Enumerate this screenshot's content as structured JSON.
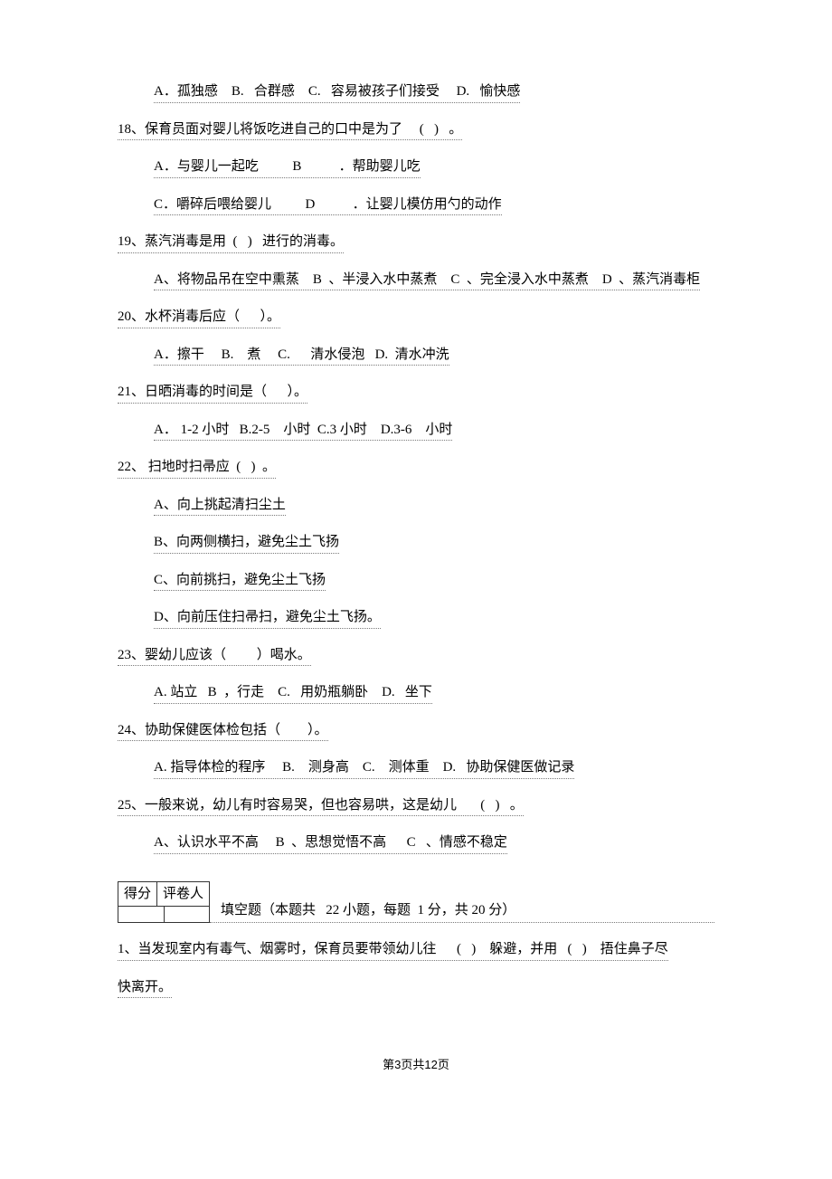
{
  "q17_opts": "A．孤独感    B.   合群感    C.   容易被孩子们接受     D.   愉快感",
  "q18": "18、保育员面对婴儿将饭吃进自己的口中是为了     (   )   。",
  "q18_a": "A．与婴儿一起吃          B           ．帮助婴儿吃",
  "q18_b": "C．嚼碎后喂给婴儿          D           ．让婴儿模仿用勺的动作",
  "q19": "19、蒸汽消毒是用  (   )   进行的消毒。",
  "q19_a": "A、将物品吊在空中熏蒸    B  、半浸入水中蒸煮    C  、完全浸入水中蒸煮    D  、蒸汽消毒柜",
  "q20": "20、水杯消毒后应（      ）。",
  "q20_a": "A．擦干     B.    煮     C.      清水侵泡   D.  清水冲洗",
  "q21": "21、日晒消毒的时间是（      ）。",
  "q21_a": "A． 1-2 小时   B.2-5    小时  C.3 小时    D.3-6    小时",
  "q22": "22、 扫地时扫帚应  (   )  。",
  "q22_a": "A、向上挑起清扫尘土",
  "q22_b": "B、向两侧横扫，避免尘土飞扬",
  "q22_c": "C、向前挑扫，避免尘土飞扬",
  "q22_d": "D、向前压住扫帚扫，避免尘土飞扬。",
  "q23": "23、婴幼儿应该（         ）喝水。",
  "q23_a": "A. 站立   B  ，行走    C.   用奶瓶躺卧    D.   坐下",
  "q24": "24、协助保健医体检包括（        ）。",
  "q24_a": "A. 指导体检的程序     B.    测身高    C.    测体重    D.   协助保健医做记录",
  "q25": "25、一般来说，幼儿有时容易哭，但也容易哄，这是幼儿       (   )   。",
  "q25_a": "A、认识水平不高     B  、思想觉悟不高      C   、情感不稳定",
  "score_label_1": "得分",
  "score_label_2": "评卷人",
  "section2": "填空题（本题共   22 小题，每题  1 分，共 20 分）",
  "s2_q1": "1、当发现室内有毒气、烟雾时，保育员要带领幼儿往      (   )    躲避，并用   (   )    捂住鼻子尽",
  "s2_q1b": "快离开。",
  "footer": "第3页共12页"
}
